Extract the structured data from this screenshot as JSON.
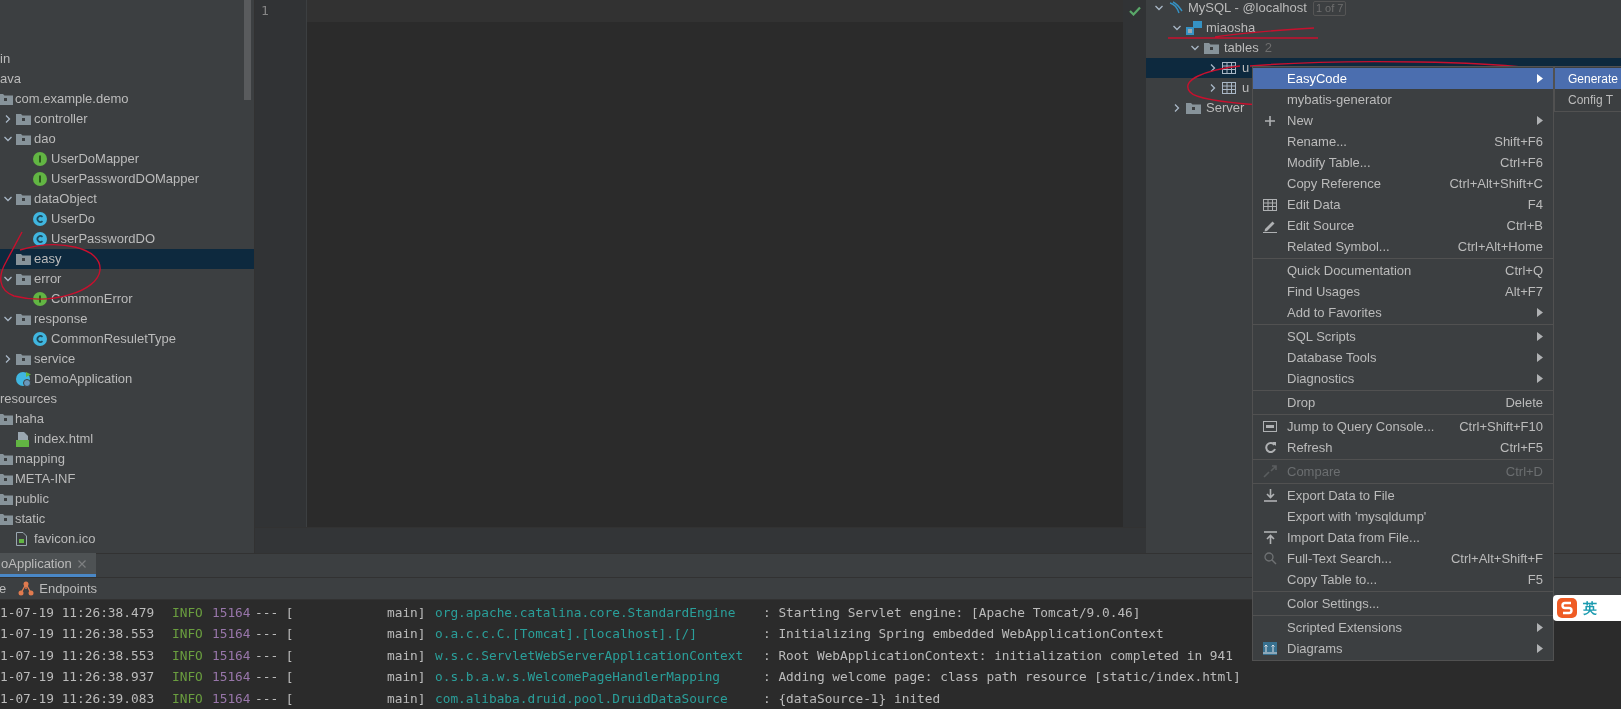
{
  "project_tree": {
    "items": [
      {
        "label": "in",
        "selected": false,
        "children": [
          {
            "label": "ava",
            "selected": false,
            "children": [
              {
                "label": "com.example.demo",
                "kind": "folder",
                "selected": false,
                "children": [
                  {
                    "label": "controller",
                    "kind": "folder",
                    "expanded": false,
                    "selected": false
                  },
                  {
                    "label": "dao",
                    "kind": "folder",
                    "expanded": true,
                    "selected": false,
                    "children": [
                      {
                        "label": "UserDoMapper",
                        "kind": "interface",
                        "selected": false
                      },
                      {
                        "label": "UserPasswordDOMapper",
                        "kind": "interface",
                        "selected": false
                      }
                    ]
                  },
                  {
                    "label": "dataObject",
                    "kind": "folder",
                    "expanded": true,
                    "selected": false,
                    "children": [
                      {
                        "label": "UserDo",
                        "kind": "class",
                        "selected": false
                      },
                      {
                        "label": "UserPasswordDO",
                        "kind": "class",
                        "selected": false
                      }
                    ]
                  },
                  {
                    "label": "easy",
                    "kind": "folder",
                    "selected": true
                  },
                  {
                    "label": "error",
                    "kind": "folder",
                    "expanded": true,
                    "selected": false,
                    "children": [
                      {
                        "label": "CommonError",
                        "kind": "interface",
                        "selected": false
                      }
                    ]
                  },
                  {
                    "label": "response",
                    "kind": "folder",
                    "expanded": true,
                    "selected": false,
                    "children": [
                      {
                        "label": "CommonResuletType",
                        "kind": "class",
                        "selected": false
                      }
                    ]
                  },
                  {
                    "label": "service",
                    "kind": "folder",
                    "expanded": false,
                    "selected": false
                  },
                  {
                    "label": "DemoApplication",
                    "kind": "app",
                    "selected": false
                  }
                ]
              }
            ]
          },
          {
            "label": "resources",
            "selected": false,
            "children": [
              {
                "label": "haha",
                "kind": "folder",
                "selected": false,
                "children": [
                  {
                    "label": "index.html",
                    "kind": "html",
                    "selected": false
                  }
                ]
              },
              {
                "label": "mapping",
                "kind": "folder",
                "selected": false
              },
              {
                "label": "META-INF",
                "kind": "folder",
                "selected": false
              },
              {
                "label": "public",
                "kind": "folder",
                "selected": false
              },
              {
                "label": "static",
                "kind": "folder",
                "selected": false,
                "children": [
                  {
                    "label": "favicon.ico",
                    "kind": "file",
                    "selected": false
                  }
                ]
              }
            ]
          }
        ]
      }
    ]
  },
  "editor": {
    "line_numbers": [
      "1"
    ]
  },
  "database_tree": {
    "items": [
      {
        "label": "MySQL - @localhost",
        "badge": "1 of 7",
        "kind": "datasource",
        "expanded": true,
        "selected": false,
        "children": [
          {
            "label": "miaosha",
            "kind": "schema",
            "expanded": true,
            "selected": false,
            "children": [
              {
                "label": "tables",
                "count": "2",
                "kind": "folder",
                "expanded": true,
                "selected": false,
                "children": [
                  {
                    "label": "u",
                    "kind": "table",
                    "expanded": false,
                    "selected": true
                  },
                  {
                    "label": "u",
                    "kind": "table",
                    "expanded": false,
                    "selected": false
                  }
                ]
              }
            ]
          },
          {
            "label": "Server",
            "kind": "folder",
            "expanded": false,
            "selected": false
          }
        ]
      }
    ]
  },
  "context_menu": {
    "items": [
      {
        "kind": "plain",
        "label": "EasyCode",
        "submenu": true,
        "selected": true,
        "disabled": false
      },
      {
        "kind": "plain",
        "label": "mybatis-generator",
        "submenu": false,
        "selected": false,
        "disabled": false
      },
      {
        "kind": "new",
        "label": "New",
        "submenu": true,
        "selected": false,
        "disabled": false
      },
      {
        "kind": "plain",
        "label": "Rename...",
        "shortcut": "Shift+F6",
        "submenu": false,
        "selected": false,
        "disabled": false
      },
      {
        "kind": "plain",
        "label": "Modify Table...",
        "shortcut": "Ctrl+F6",
        "submenu": false,
        "selected": false,
        "disabled": false
      },
      {
        "kind": "plain",
        "label": "Copy Reference",
        "shortcut": "Ctrl+Alt+Shift+C",
        "submenu": false,
        "selected": false,
        "disabled": false
      },
      {
        "kind": "grid",
        "label": "Edit Data",
        "shortcut": "F4",
        "submenu": false,
        "selected": false,
        "disabled": false
      },
      {
        "kind": "pencil",
        "label": "Edit Source",
        "shortcut": "Ctrl+B",
        "submenu": false,
        "selected": false,
        "disabled": false
      },
      {
        "kind": "plain",
        "label": "Related Symbol...",
        "shortcut": "Ctrl+Alt+Home",
        "submenu": false,
        "selected": false,
        "disabled": false
      },
      {
        "kind": "separator"
      },
      {
        "kind": "plain",
        "label": "Quick Documentation",
        "shortcut": "Ctrl+Q",
        "submenu": false,
        "selected": false,
        "disabled": false
      },
      {
        "kind": "plain",
        "label": "Find Usages",
        "shortcut": "Alt+F7",
        "submenu": false,
        "selected": false,
        "disabled": false
      },
      {
        "kind": "plain",
        "label": "Add to Favorites",
        "submenu": true,
        "selected": false,
        "disabled": false
      },
      {
        "kind": "separator"
      },
      {
        "kind": "plain",
        "label": "SQL Scripts",
        "submenu": true,
        "selected": false,
        "disabled": false
      },
      {
        "kind": "plain",
        "label": "Database Tools",
        "submenu": true,
        "selected": false,
        "disabled": false
      },
      {
        "kind": "plain",
        "label": "Diagnostics",
        "submenu": true,
        "selected": false,
        "disabled": false
      },
      {
        "kind": "separator"
      },
      {
        "kind": "plain",
        "label": "Drop",
        "shortcut": "Delete",
        "submenu": false,
        "selected": false,
        "disabled": false
      },
      {
        "kind": "separator"
      },
      {
        "kind": "console",
        "label": "Jump to Query Console...",
        "shortcut": "Ctrl+Shift+F10",
        "submenu": false,
        "selected": false,
        "disabled": false
      },
      {
        "kind": "refresh",
        "label": "Refresh",
        "shortcut": "Ctrl+F5",
        "submenu": false,
        "selected": false,
        "disabled": false
      },
      {
        "kind": "separator"
      },
      {
        "kind": "compare",
        "label": "Compare",
        "shortcut": "Ctrl+D",
        "submenu": false,
        "selected": false,
        "disabled": true
      },
      {
        "kind": "separator"
      },
      {
        "kind": "download",
        "label": "Export Data to File",
        "submenu": false,
        "selected": false,
        "disabled": false
      },
      {
        "kind": "plain",
        "label": "Export with 'mysqldump'",
        "submenu": false,
        "selected": false,
        "disabled": false
      },
      {
        "kind": "upload",
        "label": "Import Data from File...",
        "submenu": false,
        "selected": false,
        "disabled": false
      },
      {
        "kind": "search",
        "label": "Full-Text Search...",
        "shortcut": "Ctrl+Alt+Shift+F",
        "submenu": false,
        "selected": false,
        "disabled": false
      },
      {
        "kind": "plain",
        "label": "Copy Table to...",
        "shortcut": "F5",
        "submenu": false,
        "selected": false,
        "disabled": false
      },
      {
        "kind": "separator"
      },
      {
        "kind": "plain",
        "label": "Color Settings...",
        "submenu": false,
        "selected": false,
        "disabled": false
      },
      {
        "kind": "separator"
      },
      {
        "kind": "plain",
        "label": "Scripted Extensions",
        "submenu": true,
        "selected": false,
        "disabled": false
      },
      {
        "kind": "diagram",
        "label": "Diagrams",
        "submenu": true,
        "selected": false,
        "disabled": false
      }
    ]
  },
  "submenu": {
    "items": [
      {
        "label": "Generate",
        "selected": true
      },
      {
        "label": "Config T",
        "selected": false
      }
    ]
  },
  "run_panel": {
    "tab": {
      "label": "oApplication",
      "selected": true
    },
    "toolbar": [
      {
        "kind": "plain",
        "label": "e"
      },
      {
        "kind": "endpoints",
        "label": "Endpoints"
      }
    ],
    "log_lines": [
      {
        "date": "1-07-19 11:26:38.479",
        "level": "INFO",
        "pid": "15164",
        "separator": "--- [",
        "thread": "main]",
        "logger": "org.apache.catalina.core.StandardEngine",
        "message": ": Starting Servlet engine: [Apache Tomcat/9.0.46]"
      },
      {
        "date": "1-07-19 11:26:38.553",
        "level": "INFO",
        "pid": "15164",
        "separator": "--- [",
        "thread": "main]",
        "logger": "o.a.c.c.C.[Tomcat].[localhost].[/]",
        "message": ": Initializing Spring embedded WebApplicationContext"
      },
      {
        "date": "1-07-19 11:26:38.553",
        "level": "INFO",
        "pid": "15164",
        "separator": "--- [",
        "thread": "main]",
        "logger": "w.s.c.ServletWebServerApplicationContext",
        "message": ": Root WebApplicationContext: initialization completed in 941"
      },
      {
        "date": "1-07-19 11:26:38.937",
        "level": "INFO",
        "pid": "15164",
        "separator": "--- [",
        "thread": "main]",
        "logger": "o.s.b.a.w.s.WelcomePageHandlerMapping",
        "message": ": Adding welcome page: class path resource [static/index.html]"
      },
      {
        "date": "1-07-19 11:26:39.083",
        "level": "INFO",
        "pid": "15164",
        "separator": "--- [",
        "thread": "main]",
        "logger": "com.alibaba.druid.pool.DruidDataSource",
        "message": ": {dataSource-1} inited"
      }
    ]
  },
  "ime_indicator": {
    "label": "英"
  }
}
